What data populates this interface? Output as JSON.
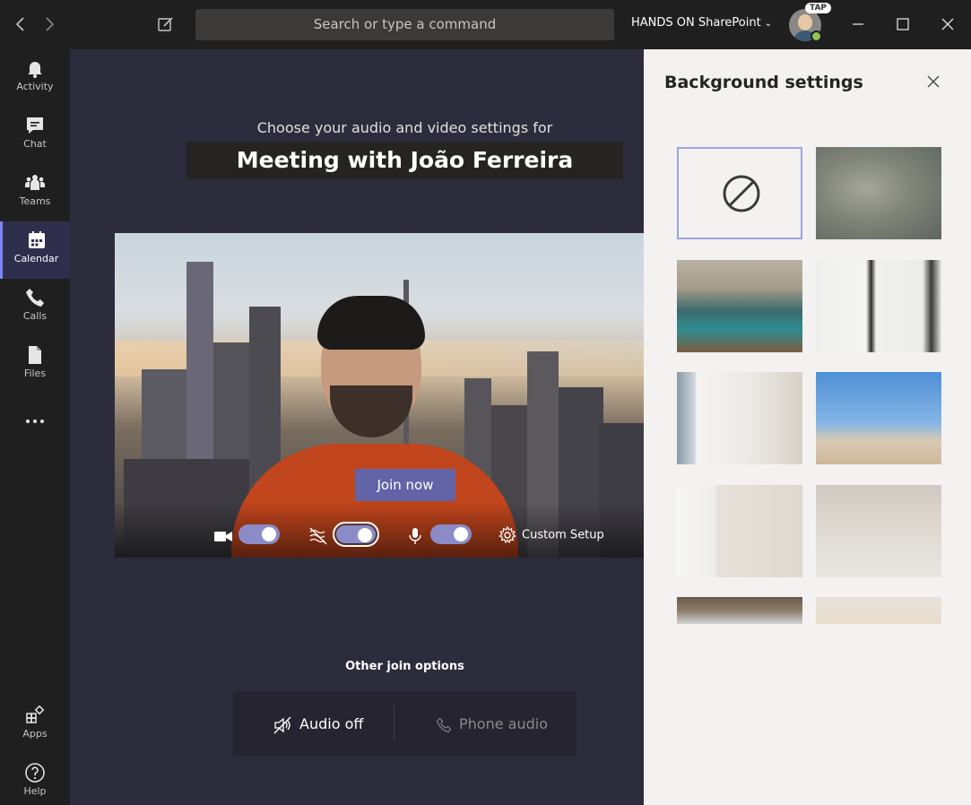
{
  "titlebar": {
    "search_placeholder": "Search or type a command",
    "tenant_name": "HANDS ON SharePoint",
    "avatar_badge": "TAP"
  },
  "rail": {
    "items": [
      {
        "label": "Activity",
        "icon": "bell-icon"
      },
      {
        "label": "Chat",
        "icon": "chat-icon"
      },
      {
        "label": "Teams",
        "icon": "teams-icon"
      },
      {
        "label": "Calendar",
        "icon": "calendar-icon",
        "active": true
      },
      {
        "label": "Calls",
        "icon": "phone-icon"
      },
      {
        "label": "Files",
        "icon": "file-icon"
      }
    ],
    "more_icon": "more-icon",
    "bottom": [
      {
        "label": "Apps",
        "icon": "apps-icon"
      },
      {
        "label": "Help",
        "icon": "help-icon"
      }
    ]
  },
  "meeting": {
    "subtitle": "Choose your audio and video settings for",
    "title": "Meeting with João Ferreira",
    "join_label": "Join now",
    "custom_setup_label": "Custom Setup",
    "other_join_label": "Other join options",
    "audio_off_label": "Audio off",
    "phone_audio_label": "Phone audio"
  },
  "panel": {
    "title": "Background settings",
    "backgrounds": [
      {
        "name": "none",
        "selected": true
      },
      {
        "name": "blur"
      },
      {
        "name": "office-lockers"
      },
      {
        "name": "white-room-mirror"
      },
      {
        "name": "bright-room-window"
      },
      {
        "name": "beach-lifeguard"
      },
      {
        "name": "empty-corner-room"
      },
      {
        "name": "soft-wall"
      },
      {
        "name": "loft-ceiling"
      },
      {
        "name": "city-skyline"
      }
    ]
  },
  "colors": {
    "accent": "#6264a7",
    "toggle_on": "#8b8cc7",
    "rail_active": "#2f2e4d",
    "main_bg": "#2d2c3c",
    "panel_bg": "#f3f2f1"
  }
}
